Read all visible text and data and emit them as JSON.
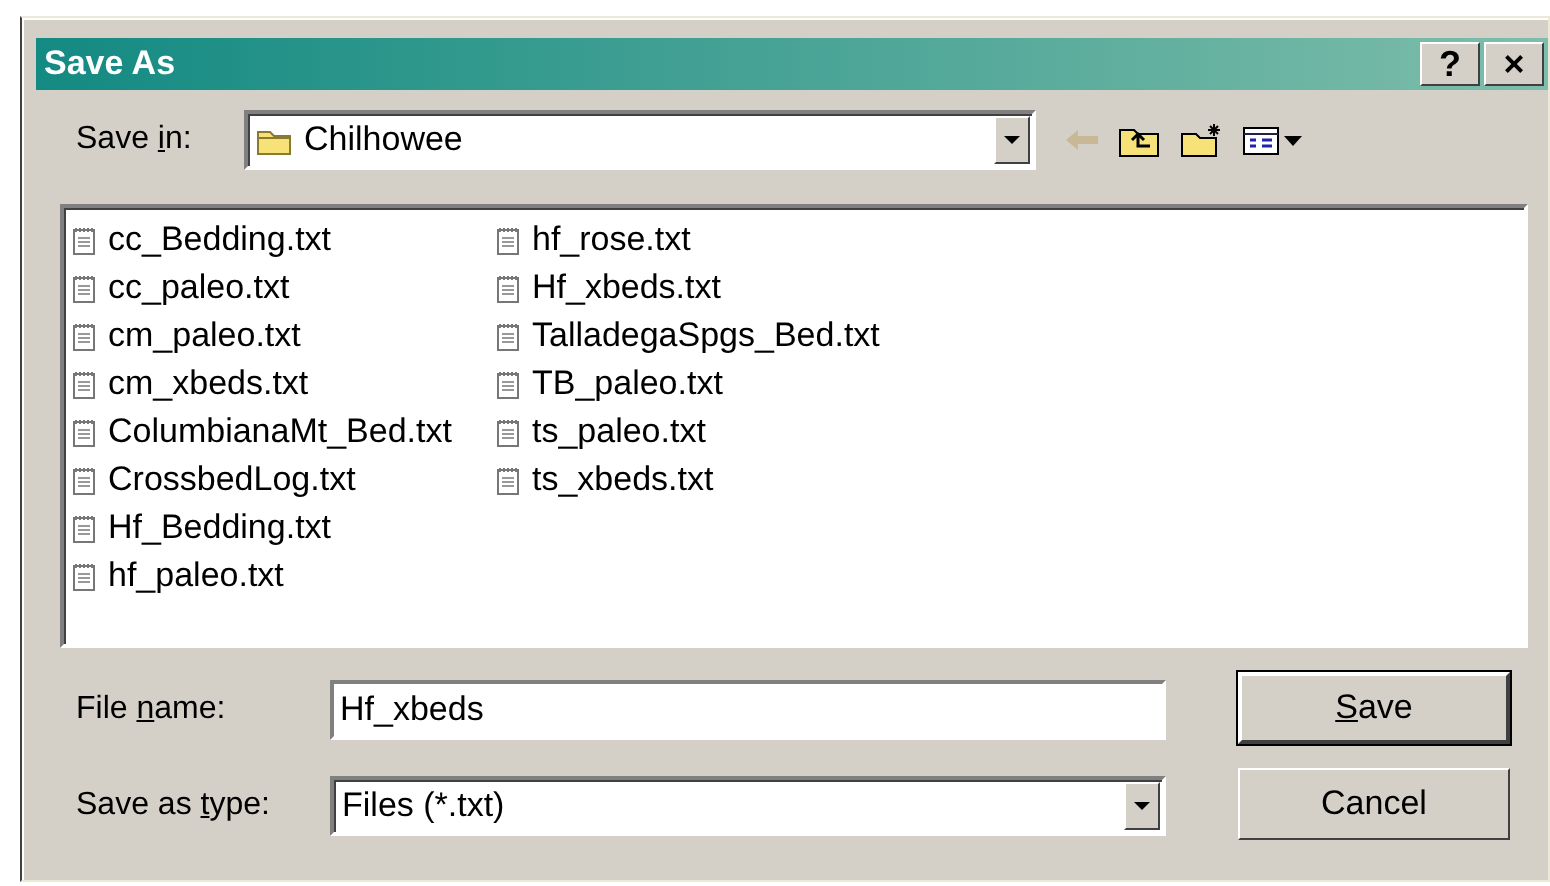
{
  "window": {
    "title": "Save As",
    "title_buttons": [
      "?",
      "×"
    ]
  },
  "save_in": {
    "label": [
      {
        "text": "Save ",
        "underline": false
      },
      {
        "text": "i",
        "underline": true
      },
      {
        "text": "n:",
        "underline": false
      }
    ],
    "value": "Chilhowee"
  },
  "toolbar": [
    {
      "kind": "back",
      "disabled": true
    },
    {
      "kind": "up",
      "disabled": false
    },
    {
      "kind": "new_folder",
      "disabled": false
    },
    {
      "kind": "view_menu",
      "disabled": false
    }
  ],
  "files": [
    {
      "name": "cc_Bedding.txt"
    },
    {
      "name": "cc_paleo.txt"
    },
    {
      "name": "cm_paleo.txt"
    },
    {
      "name": "cm_xbeds.txt"
    },
    {
      "name": "ColumbianaMt_Bed.txt"
    },
    {
      "name": "CrossbedLog.txt"
    },
    {
      "name": "Hf_Bedding.txt"
    },
    {
      "name": "hf_paleo.txt"
    },
    {
      "name": "hf_rose.txt"
    },
    {
      "name": "Hf_xbeds.txt"
    },
    {
      "name": "TalladegaSpgs_Bed.txt"
    },
    {
      "name": "TB_paleo.txt"
    },
    {
      "name": "ts_paleo.txt"
    },
    {
      "name": "ts_xbeds.txt"
    }
  ],
  "file_name": {
    "label": [
      {
        "text": "File ",
        "underline": false
      },
      {
        "text": "n",
        "underline": true
      },
      {
        "text": "ame:",
        "underline": false
      }
    ],
    "value": "Hf_xbeds"
  },
  "save_as_type": {
    "label": [
      {
        "text": "Save as ",
        "underline": false
      },
      {
        "text": "t",
        "underline": true
      },
      {
        "text": "ype:",
        "underline": false
      }
    ],
    "value": "Files (*.txt)"
  },
  "buttons": [
    {
      "label": [
        {
          "text": "S",
          "underline": true
        },
        {
          "text": "ave",
          "underline": false
        }
      ],
      "default": true
    },
    {
      "label": [
        {
          "text": "Cancel",
          "underline": false
        }
      ],
      "default": false
    }
  ]
}
